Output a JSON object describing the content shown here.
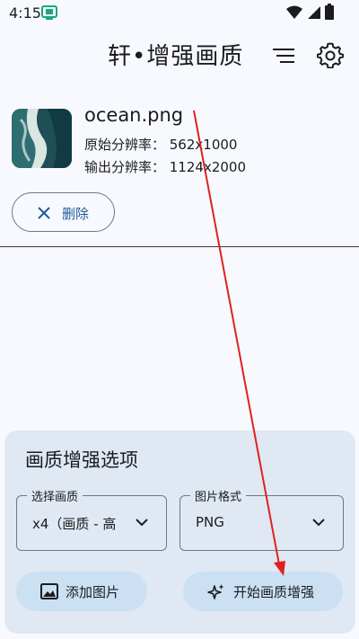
{
  "status_bar": {
    "time": "4:15"
  },
  "header": {
    "title": "轩•增强画质",
    "menu_icon": "menu-icon",
    "settings_icon": "gear-icon"
  },
  "file": {
    "name": "ocean.png",
    "original_resolution": "原始分辨率：  562x1000",
    "output_resolution": "输出分辨率：  1124x2000",
    "delete_label": "删除"
  },
  "options": {
    "title": "画质增强选项",
    "quality_label": "选择画质",
    "quality_value": "x4（画质 - 高",
    "format_label": "图片格式",
    "format_value": "PNG",
    "add_image_label": "添加图片",
    "start_label": "开始画质增强"
  },
  "colors": {
    "background": "#f8f9ff",
    "panel": "#dfe8f3",
    "button": "#cce0f4",
    "accent_text": "#1e5c9a",
    "annotation": "#e02020"
  }
}
